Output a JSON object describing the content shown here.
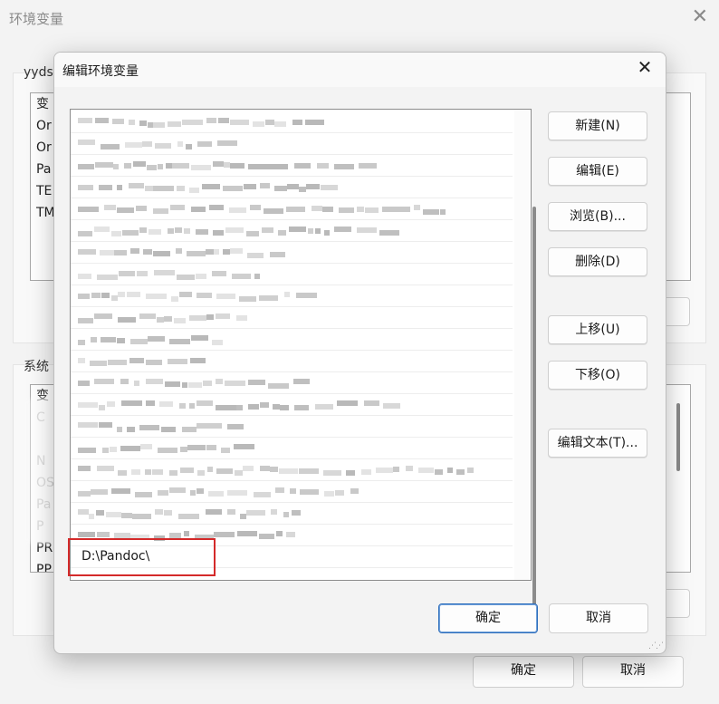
{
  "background_window": {
    "title": "环境变量",
    "user_group_label": "yyds",
    "user_list_header": "变",
    "user_rows": [
      "Or",
      "Or",
      "Pa",
      "TE",
      "TM"
    ],
    "system_group_label": "系统",
    "system_list_header": "变",
    "system_rows": [
      "C",
      "",
      "N",
      "OS",
      "Pa",
      "P",
      "PR",
      "PP"
    ],
    "ok_label": "确定",
    "cancel_label": "取消"
  },
  "dialog": {
    "title": "编辑环境变量",
    "entries": [
      "",
      "",
      "",
      "",
      "",
      "",
      "",
      "",
      "",
      "",
      "",
      "",
      "",
      "",
      "",
      "",
      "",
      "",
      "",
      "",
      "D:\\Pandoc\\"
    ],
    "buttons": {
      "new": "新建(N)",
      "edit": "编辑(E)",
      "browse": "浏览(B)...",
      "delete": "删除(D)",
      "move_up": "上移(U)",
      "move_down": "下移(O)",
      "edit_text": "编辑文本(T)..."
    },
    "ok_label": "确定",
    "cancel_label": "取消"
  },
  "colors": {
    "highlight": "#d42a2a",
    "default_button_border": "#2f6fbd"
  },
  "icons": {
    "close": "close-icon",
    "resize": "resize-grip-icon"
  }
}
